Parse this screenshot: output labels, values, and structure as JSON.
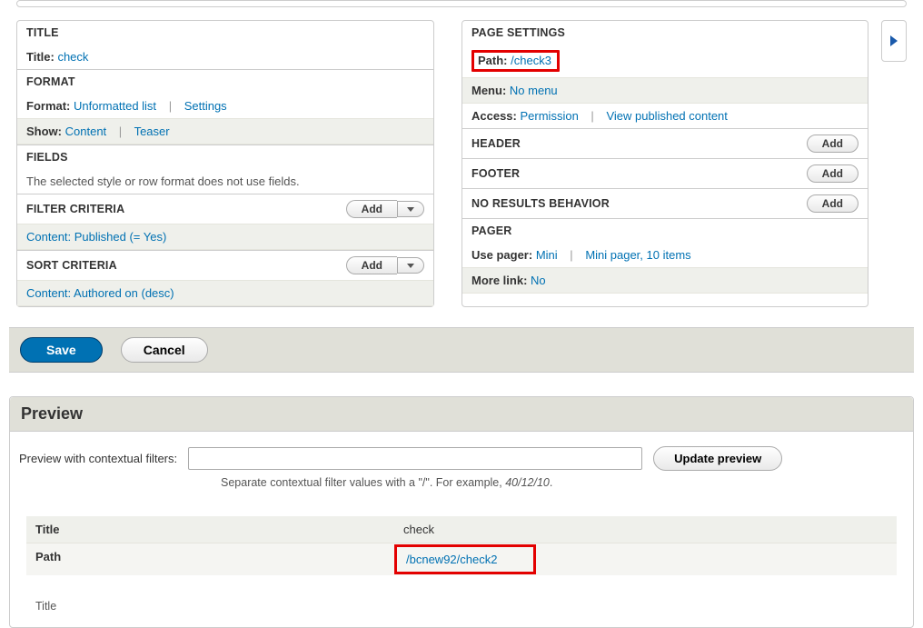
{
  "left": {
    "title": {
      "heading": "TITLE",
      "label": "Title:",
      "value": "check"
    },
    "format": {
      "heading": "FORMAT",
      "format_label": "Format:",
      "format_value": "Unformatted list",
      "settings": "Settings",
      "show_label": "Show:",
      "show_value": "Content",
      "teaser": "Teaser"
    },
    "fields": {
      "heading": "FIELDS",
      "message": "The selected style or row format does not use fields."
    },
    "filter": {
      "heading": "FILTER CRITERIA",
      "add": "Add",
      "item": "Content: Published (= Yes)"
    },
    "sort": {
      "heading": "SORT CRITERIA",
      "add": "Add",
      "item": "Content: Authored on (desc)"
    }
  },
  "right": {
    "page": {
      "heading": "PAGE SETTINGS",
      "path_label": "Path:",
      "path_value": "/check3",
      "menu_label": "Menu:",
      "menu_value": "No menu",
      "access_label": "Access:",
      "access_value": "Permission",
      "access_link": "View published content"
    },
    "header": {
      "heading": "HEADER",
      "add": "Add"
    },
    "footer": {
      "heading": "FOOTER",
      "add": "Add"
    },
    "nores": {
      "heading": "NO RESULTS BEHAVIOR",
      "add": "Add"
    },
    "pager": {
      "heading": "PAGER",
      "use_label": "Use pager:",
      "use_value": "Mini",
      "use_link": "Mini pager, 10 items",
      "more_label": "More link:",
      "more_value": "No"
    }
  },
  "actions": {
    "save": "Save",
    "cancel": "Cancel"
  },
  "preview": {
    "heading": "Preview",
    "filter_label": "Preview with contextual filters:",
    "update": "Update preview",
    "help_a": "Separate contextual filter values with a \"/\". For example, ",
    "help_b": "40/12/10",
    "help_c": ".",
    "table": {
      "title_label": "Title",
      "title_value": "check",
      "path_label": "Path",
      "path_value": "/bcnew92/check2"
    },
    "bottom_title": "Title"
  }
}
